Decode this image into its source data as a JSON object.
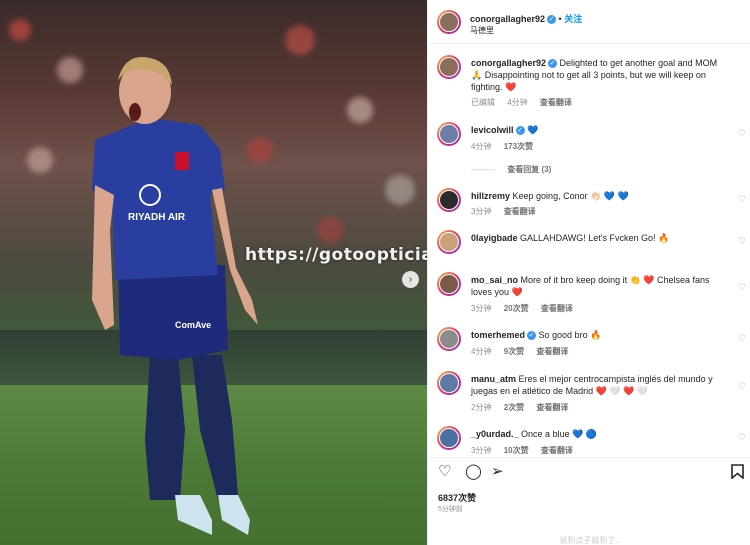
{
  "watermark": "https://gotooptician.com/",
  "post": {
    "username": "conorgallagher92",
    "follow_label": "关注",
    "location": "马德里",
    "caption_user": "conorgallagher92",
    "caption": "Delighted to get another goal and MOM 🙏 Disappointing not to get all 3 points, but we will keep on fighting. ❤️",
    "caption_meta": {
      "edited": "已编辑",
      "time": "4分钟",
      "translate": "查看翻译"
    },
    "likes": "6837次赞",
    "time": "5分钟前",
    "footer": "说到点子就到了.."
  },
  "comments": [
    {
      "user": "levicolwill",
      "verified": true,
      "text": "💙",
      "time": "4分钟",
      "likes": "173次赞",
      "translate": "",
      "replies": "查看回复 (3)"
    },
    {
      "user": "hillzremy",
      "verified": false,
      "text": "Keep going, Conor 👏🏻 💙 💙",
      "time": "3分钟",
      "likes": "",
      "translate": "查看翻译"
    },
    {
      "user": "0layigbade",
      "verified": false,
      "text": "GALLAHDAWG! Let's Fvcken Go! 🔥",
      "time": "",
      "likes": "",
      "translate": ""
    },
    {
      "user": "mo_sai_no",
      "verified": false,
      "text": "More of it bro keep doing it 👏 ❤️ Chelsea fans loves you ❤️",
      "time": "3分钟",
      "likes": "20次赞",
      "translate": "查看翻译"
    },
    {
      "user": "tomerhemed",
      "verified": true,
      "text": "So good bro 🔥",
      "time": "4分钟",
      "likes": "9次赞",
      "translate": "查看翻译"
    },
    {
      "user": "manu_atm",
      "verified": false,
      "text": "Eres el mejor centrocampista inglés del mundo y juegas en el atlético de Madrid ❤️ 🤍 ❤️ 🤍",
      "time": "2分钟",
      "likes": "2次赞",
      "translate": "查看翻译"
    },
    {
      "user": "_y0urdad._",
      "verified": false,
      "text": "Once a blue 💙 🔵",
      "time": "3分钟",
      "likes": "10次赞",
      "translate": "查看翻译"
    }
  ],
  "icons": [
    "heart-icon",
    "comment-icon",
    "share-icon",
    "bookmark-icon",
    "next-icon",
    "verified-icon"
  ],
  "colors": {
    "follow": "#0095f6",
    "verified": "#3897f0",
    "meta": "#8e8e8e"
  }
}
